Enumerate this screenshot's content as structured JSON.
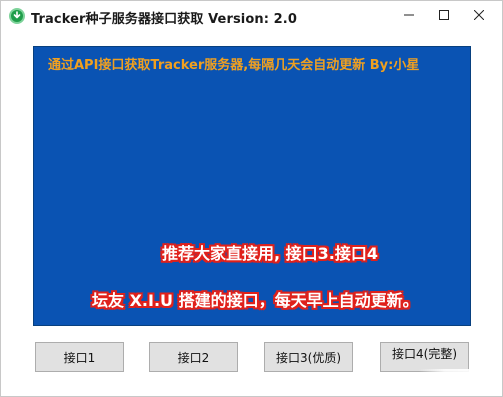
{
  "window": {
    "title": "Tracker种子服务器接口获取    Version: 2.0"
  },
  "display": {
    "header": "通过API接口获取Tracker服务器,每隔几天会自动更新 By:小星",
    "notice_1": "推荐大家直接用, 接口3.接口4",
    "notice_2": "坛友 X.I.U 搭建的接口，每天早上自动更新。"
  },
  "buttons": [
    {
      "label": "接口1"
    },
    {
      "label": "接口2"
    },
    {
      "label": "接口3(优质)"
    },
    {
      "label": "接口4(完整)"
    }
  ],
  "colors": {
    "display_bg": "#0a53b3",
    "header_text": "#f0a020",
    "notice_outline": "#e0211b",
    "icon_green": "#1f9d4a"
  },
  "icons": {
    "app": "download-circle-icon",
    "minimize": "minimize-icon",
    "maximize": "maximize-icon",
    "close": "close-icon"
  }
}
